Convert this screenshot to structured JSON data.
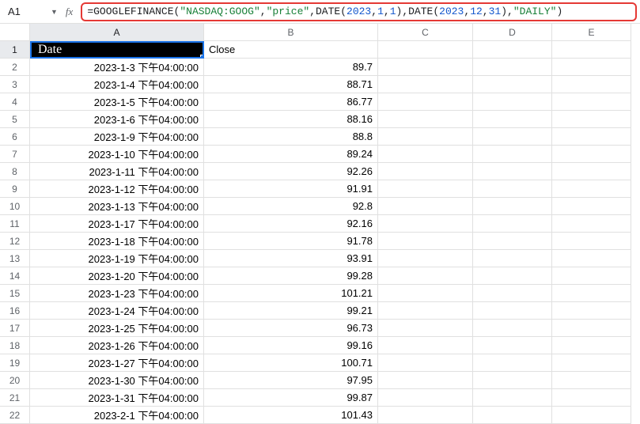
{
  "namebox": {
    "value": "A1"
  },
  "fx_label": "fx",
  "formula": {
    "fn1": "=GOOGLEFINANCE",
    "p1": "(",
    "s1": "\"NASDAQ:GOOG\"",
    "c1": ", ",
    "s2": "\"price\"",
    "c2": ", ",
    "fn2": "DATE",
    "p2": "(",
    "n1": "2023",
    "cm1": ",",
    "n2": "1",
    "cm2": ",",
    "n3": "1",
    "p3": ")",
    "c3": ", ",
    "fn3": "DATE",
    "p4": "(",
    "n4": "2023",
    "cm3": ",",
    "n5": "12",
    "cm4": ",",
    "n6": "31",
    "p5": ")",
    "c4": ", ",
    "s3": "\"DAILY\"",
    "p6": ")"
  },
  "columns": [
    "A",
    "B",
    "C",
    "D",
    "E"
  ],
  "header_row": {
    "a": "Date",
    "b": "Close"
  },
  "rows": [
    {
      "n": "2",
      "a": "2023-1-3 下午04:00:00",
      "b": "89.7"
    },
    {
      "n": "3",
      "a": "2023-1-4 下午04:00:00",
      "b": "88.71"
    },
    {
      "n": "4",
      "a": "2023-1-5 下午04:00:00",
      "b": "86.77"
    },
    {
      "n": "5",
      "a": "2023-1-6 下午04:00:00",
      "b": "88.16"
    },
    {
      "n": "6",
      "a": "2023-1-9 下午04:00:00",
      "b": "88.8"
    },
    {
      "n": "7",
      "a": "2023-1-10 下午04:00:00",
      "b": "89.24"
    },
    {
      "n": "8",
      "a": "2023-1-11 下午04:00:00",
      "b": "92.26"
    },
    {
      "n": "9",
      "a": "2023-1-12 下午04:00:00",
      "b": "91.91"
    },
    {
      "n": "10",
      "a": "2023-1-13 下午04:00:00",
      "b": "92.8"
    },
    {
      "n": "11",
      "a": "2023-1-17 下午04:00:00",
      "b": "92.16"
    },
    {
      "n": "12",
      "a": "2023-1-18 下午04:00:00",
      "b": "91.78"
    },
    {
      "n": "13",
      "a": "2023-1-19 下午04:00:00",
      "b": "93.91"
    },
    {
      "n": "14",
      "a": "2023-1-20 下午04:00:00",
      "b": "99.28"
    },
    {
      "n": "15",
      "a": "2023-1-23 下午04:00:00",
      "b": "101.21"
    },
    {
      "n": "16",
      "a": "2023-1-24 下午04:00:00",
      "b": "99.21"
    },
    {
      "n": "17",
      "a": "2023-1-25 下午04:00:00",
      "b": "96.73"
    },
    {
      "n": "18",
      "a": "2023-1-26 下午04:00:00",
      "b": "99.16"
    },
    {
      "n": "19",
      "a": "2023-1-27 下午04:00:00",
      "b": "100.71"
    },
    {
      "n": "20",
      "a": "2023-1-30 下午04:00:00",
      "b": "97.95"
    },
    {
      "n": "21",
      "a": "2023-1-31 下午04:00:00",
      "b": "99.87"
    },
    {
      "n": "22",
      "a": "2023-2-1 下午04:00:00",
      "b": "101.43"
    }
  ]
}
